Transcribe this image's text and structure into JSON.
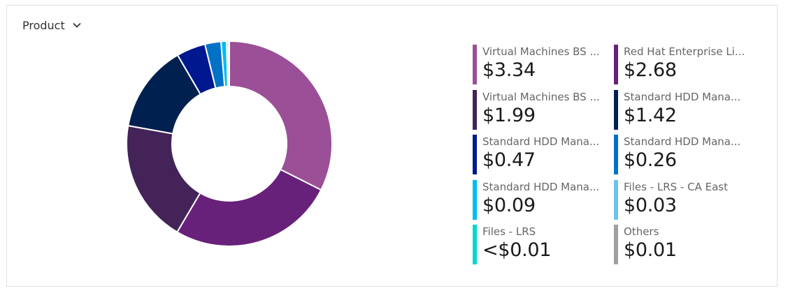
{
  "dropdown": {
    "label": "Product",
    "icon": "chevron-down-icon"
  },
  "chart_data": {
    "type": "pie",
    "variant": "donut",
    "labels": [
      "Virtual Machines BS ...",
      "Red Hat Enterprise Li...",
      "Virtual Machines BS ...",
      "Standard HDD Mana...",
      "Standard HDD Mana...",
      "Standard HDD Mana...",
      "Standard HDD Mana...",
      "Files - LRS - CA East",
      "Files - LRS",
      "Others"
    ],
    "values": [
      3.34,
      2.68,
      1.99,
      1.42,
      0.47,
      0.26,
      0.09,
      0.03,
      0.004,
      0.01
    ],
    "value_labels": [
      "$3.34",
      "$2.68",
      "$1.99",
      "$1.42",
      "$0.47",
      "$0.26",
      "$0.09",
      "$0.03",
      "<$0.01",
      "$0.01"
    ],
    "colors": [
      "#9b4f96",
      "#68217a",
      "#442359",
      "#002050",
      "#00188f",
      "#0072c6",
      "#00bcf2",
      "#6dc2e9",
      "#00d8cc",
      "#a0a0a0"
    ],
    "legend_position": "right"
  }
}
